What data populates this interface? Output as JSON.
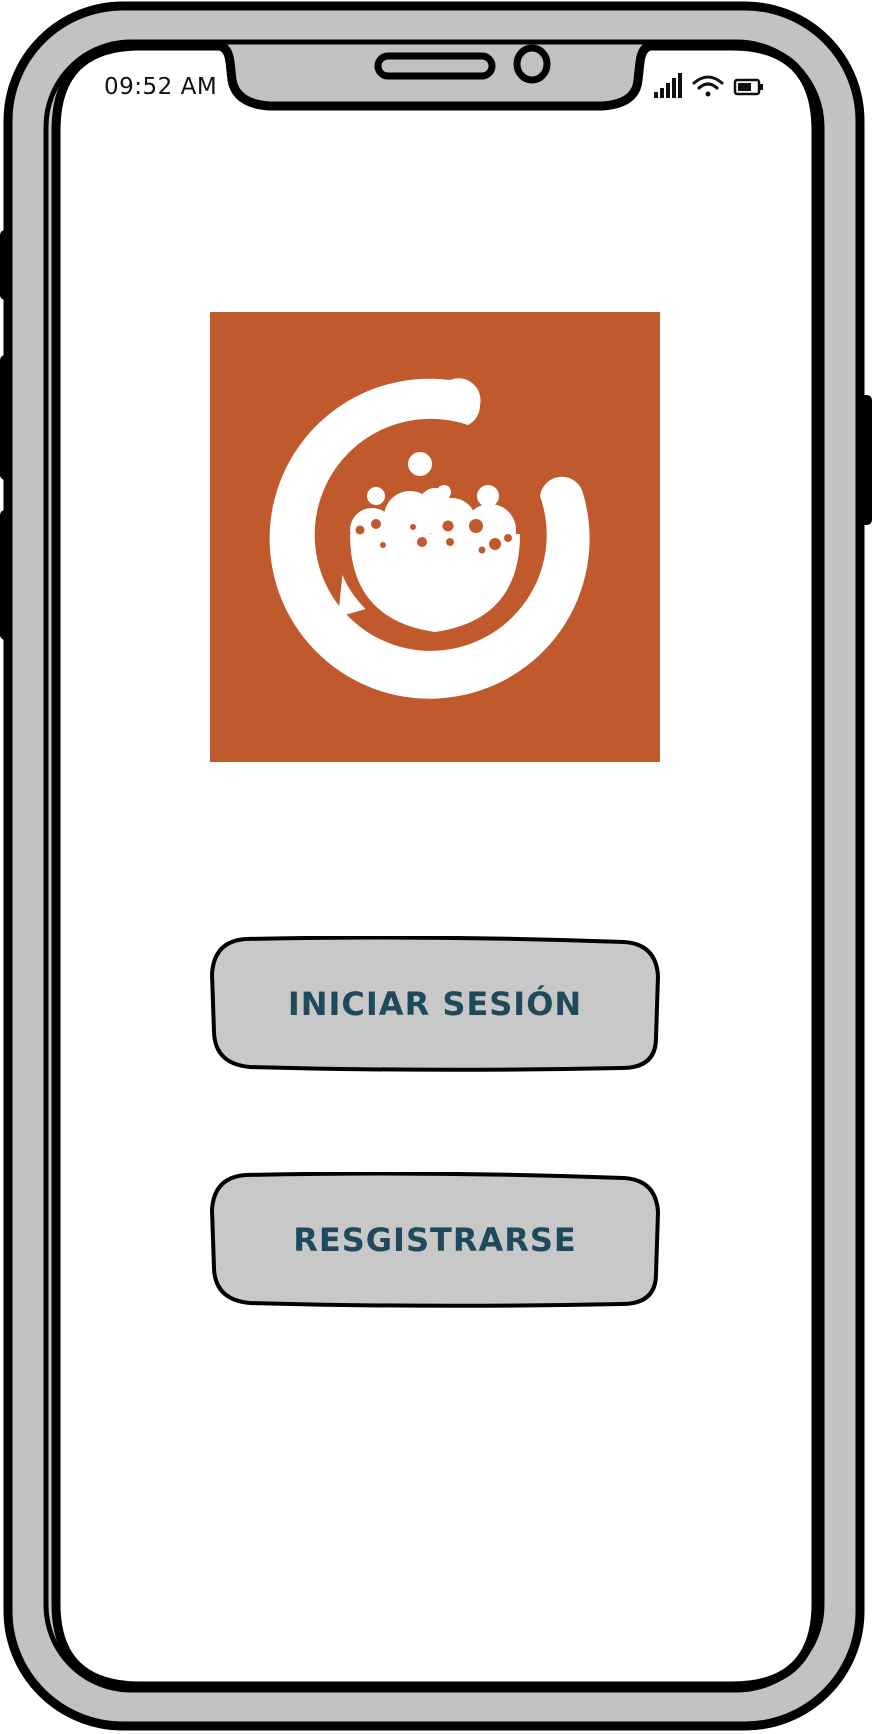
{
  "status_bar": {
    "time": "09:52 AM",
    "icons": [
      "cellular-signal-icon",
      "wifi-icon",
      "battery-icon"
    ]
  },
  "logo": {
    "icon": "app-logo-icon",
    "background_color": "#c05a2c",
    "foreground_color": "#ffffff"
  },
  "actions": {
    "login_label": "INICIAR SESIÓN",
    "register_label": "RESGISTRARSE"
  },
  "colors": {
    "frame": "#c2c2c2",
    "outline": "#000000",
    "button_fill": "#c8c8c8",
    "button_text": "#1e4a5c",
    "screen": "#ffffff"
  }
}
